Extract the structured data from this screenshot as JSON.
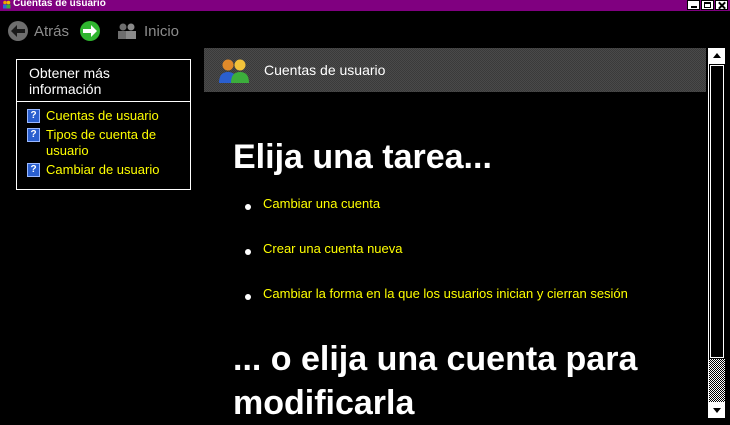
{
  "window": {
    "title": "Cuentas de usuario",
    "icon": "users-icon"
  },
  "nav": {
    "back_label": "Atrás",
    "forward_icon": "forward-arrow-icon",
    "home_label": "Inicio"
  },
  "sidebar": {
    "title": "Obtener más información",
    "links": [
      {
        "label": "Cuentas de usuario",
        "icon": "help-icon"
      },
      {
        "label": "Tipos de cuenta de usuario",
        "icon": "help-icon"
      },
      {
        "label": "Cambiar de usuario",
        "icon": "help-icon"
      }
    ]
  },
  "header": {
    "title": "Cuentas de usuario"
  },
  "main": {
    "task_heading": "Elija una tarea...",
    "tasks": [
      "Cambiar una cuenta",
      "Crear una cuenta nueva",
      "Cambiar la forma en la que los usuarios inician y cierran sesión"
    ],
    "account_heading": "... o elija una cuenta para modificarla"
  },
  "colors": {
    "titlebar": "#800080",
    "link": "#ffff00",
    "background": "#000000",
    "text": "#ffffff"
  }
}
